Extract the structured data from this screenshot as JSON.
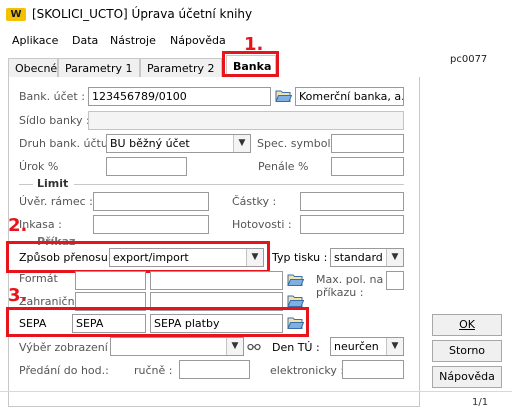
{
  "window": {
    "logo_text": "W",
    "title": "[SKOLICI_UCTO] Úprava účetní knihy"
  },
  "menu": {
    "items": [
      "Aplikace",
      "Data",
      "Nástroje",
      "Nápověda"
    ]
  },
  "form_code": "pc0077",
  "tabs": [
    "Obecné",
    "Parametry 1",
    "Parametry 2",
    "Banka"
  ],
  "active_tab": "Banka",
  "annotations": [
    "1.",
    "2.",
    "3."
  ],
  "annotation_color": "#e8141c",
  "fields": {
    "bank_account": {
      "label": "Bank. účet :",
      "value": "123456789/0100",
      "bank_name": "Komerční banka, a.s"
    },
    "bank_seat": {
      "label": "Sídlo banky :",
      "value": ""
    },
    "account_type": {
      "label": "Druh bank. účtu :",
      "value": "BU běžný účet"
    },
    "spec_symbol": {
      "label": "Spec. symbol :",
      "value": ""
    },
    "interest": {
      "label": "Úrok %",
      "value": ""
    },
    "penalty": {
      "label": "Penále %",
      "value": ""
    },
    "limit_group": "Limit",
    "credit_frame": {
      "label": "Úvěr. rámec :",
      "value": ""
    },
    "amounts": {
      "label": "Částky :",
      "value": ""
    },
    "collection": {
      "label": "Inkasa :",
      "value": ""
    },
    "cash": {
      "label": "Hotovosti :",
      "value": ""
    },
    "order_group": "Příkaz",
    "transfer_method": {
      "label": "Způsob přenosu :",
      "value": "export/import"
    },
    "print_type": {
      "label": "Typ tisku :",
      "value": "standard"
    },
    "format": {
      "label": "Formát",
      "value": ""
    },
    "max_items": {
      "label_line1": "Max. pol. na",
      "label_line2": "příkazu :",
      "value": ""
    },
    "foreign": {
      "label": "Zahraniční",
      "value": ""
    },
    "sepa": {
      "label": "SEPA",
      "code": "SEPA",
      "name": "SEPA platby"
    },
    "display_selection": {
      "label": "Výběr zobrazení :",
      "value": ""
    },
    "den_tu": {
      "label": "Den TÚ :",
      "value": "neurčen"
    },
    "handover": {
      "label": "Předání do hod.:",
      "manual_label": "ručně :",
      "manual_value": "",
      "electronic_label": "elektronicky :",
      "electronic_value": ""
    }
  },
  "buttons": {
    "ok": "OK",
    "cancel": "Storno",
    "help": "Nápověda"
  },
  "pager": "1/1"
}
